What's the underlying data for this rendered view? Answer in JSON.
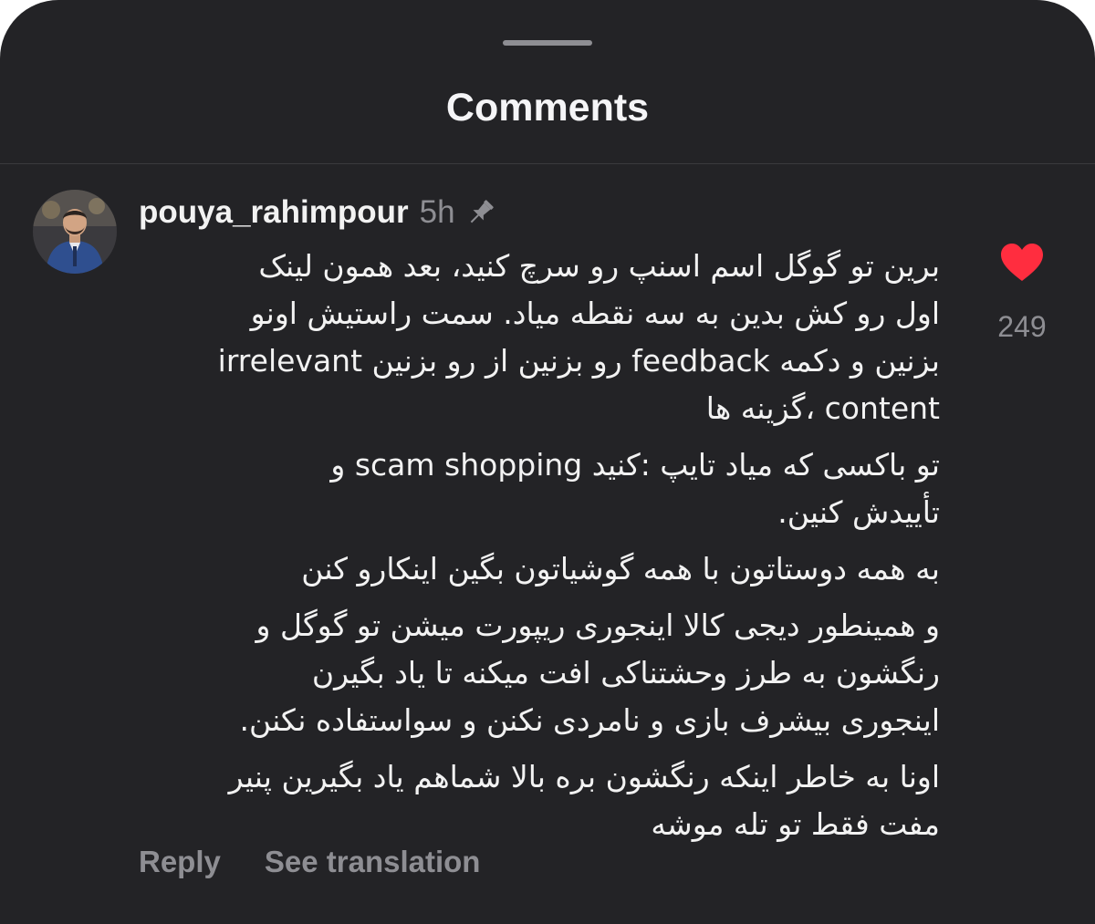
{
  "sheet": {
    "title": "Comments"
  },
  "comment": {
    "username": "pouya_rahimpour",
    "time": "5h",
    "paragraphs": [
      "برین تو گوگل اسم اسنپ رو سرچ کنید، بعد همون لینک\nاول رو کش بدین به سه نقطه میاد. سمت راستیش اونو\nبزنین و دکمه feedback رو بزنین از رو بزنین irrelevant\ncontent ،گزینه ها",
      "تو باکسی که میاد تایپ :کنید scam shopping و\nتأییدش کنین.",
      "به همه دوستاتون با همه گوشیاتون بگین اینکارو کنن",
      "و همینطور دیجی کالا اینجوری ریپورت میشن تو گوگل و\nرنگشون به طرز وحشتناکی افت میکنه تا یاد بگیرن\nاینجوری بیشرف بازی و نامردی نکنن و سواستفاده نکنن.",
      "اونا به خاطر اینکه رنگشون بره بالا شماهم یاد بگیرین پنیر\nمفت فقط تو تله موشه"
    ],
    "like_count": "249",
    "actions": {
      "reply": "Reply",
      "translate": "See translation"
    }
  },
  "icons": {
    "pin": "pin-icon",
    "like": "heart-icon"
  },
  "colors": {
    "background": "#232326",
    "like_red": "#ff2d3f",
    "secondary_text": "#8e8e93",
    "primary_text": "#f2f2f2"
  }
}
